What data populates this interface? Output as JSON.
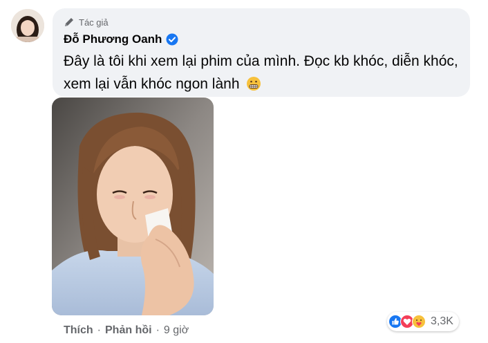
{
  "comment": {
    "author_badge": "Tác giả",
    "author_name": "Đỗ Phương Oanh",
    "text": "Đây là tôi khi xem lại phim của mình. Đọc kb khóc, diễn khóc, xem lại vẫn khóc ngon lành",
    "emoji_icon": "grimacing-face-icon",
    "actions": {
      "like_label": "Thích",
      "separator": "·",
      "reply_label": "Phản hồi",
      "time": "9 giờ"
    },
    "reactions": {
      "icons": [
        "like-icon",
        "love-icon",
        "care-icon"
      ],
      "count": "3,3K"
    }
  },
  "colors": {
    "bubble_bg": "#f0f2f5",
    "verified_blue": "#1877f2",
    "secondary_text": "#65676b"
  }
}
